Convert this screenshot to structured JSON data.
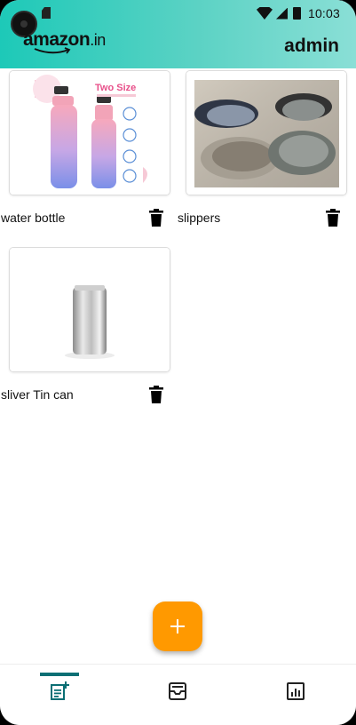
{
  "status_bar": {
    "time": "10:03"
  },
  "app_bar": {
    "logo_main": "amazon",
    "logo_suffix": ".in",
    "user_label": "admin"
  },
  "products": [
    {
      "name": "water bottle",
      "image": "water-bottle-photo",
      "image_caption": "Two Size"
    },
    {
      "name": "slippers",
      "image": "slippers-photo"
    },
    {
      "name": "sliver Tin can",
      "image": "tin-can-photo"
    }
  ],
  "fab": {
    "icon": "plus-icon"
  },
  "bottom_nav": {
    "items": [
      {
        "icon": "post-add-icon",
        "selected": true
      },
      {
        "icon": "inbox-icon",
        "selected": false
      },
      {
        "icon": "analytics-icon",
        "selected": false
      }
    ]
  },
  "colors": {
    "appbar_gradient_start": "#1dc9b8",
    "appbar_gradient_end": "#8adfd6",
    "fab": "#ff9900",
    "nav_indicator": "#0b6f74"
  }
}
